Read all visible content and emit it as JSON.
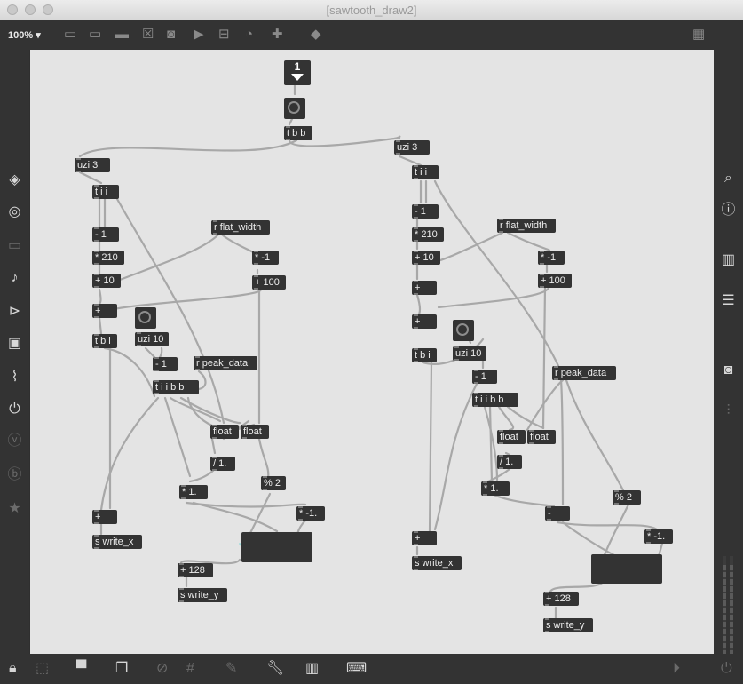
{
  "window": {
    "title": "[sawtooth_draw2]"
  },
  "toolbar": {
    "zoom": "100%"
  },
  "patch": {
    "number_box": "1",
    "objects": {
      "tbb": "t b b",
      "uzi_l": "uzi 3",
      "tii_l": "t i i",
      "m1_l": "- 1",
      "mul_l": "* 210",
      "p10_l": "+ 10",
      "plus_l": "+",
      "tbi_l": "t b i",
      "uzi10_l": "uzi 10",
      "m1b_l": "- 1",
      "tiibb_l": "t i i b b",
      "rflat_l": "r flat_width",
      "neg_l": "* -1",
      "p100_l": "+ 100",
      "rpeak_l": "r peak_data",
      "float1_l": "float",
      "float2_l": "float",
      "div_l": "/ 1.",
      "mul1_l": "* 1.",
      "mod2_l": "% 2",
      "negf_l": "* -1.",
      "plusx_l": "+",
      "swx_l": "s write_x",
      "p128_l": "+ 128",
      "swy_l": "s write_y",
      "uzi_r": "uzi 3",
      "tii_r": "t i i",
      "m1_r": "- 1",
      "mul_r": "* 210",
      "p10_r": "+ 10",
      "plus_r": "+",
      "plus2_r": "+",
      "tbi_r": "t b i",
      "uzi10_r": "uzi 10",
      "m1b_r": "- 1",
      "tiibb_r": "t i i b b",
      "rflat_r": "r flat_width",
      "neg_r": "* -1",
      "p100_r": "+ 100",
      "rpeak_r": "r peak_data",
      "float1_r": "float",
      "float2_r": "float",
      "div_r": "/ 1.",
      "mul1_r": "* 1.",
      "minus_r": "-",
      "mod2_r": "% 2",
      "negf_r": "* -1.",
      "plusx_r": "+",
      "swx_r": "s write_x",
      "p128_r": "+ 128",
      "swy_r": "s write_y"
    }
  }
}
